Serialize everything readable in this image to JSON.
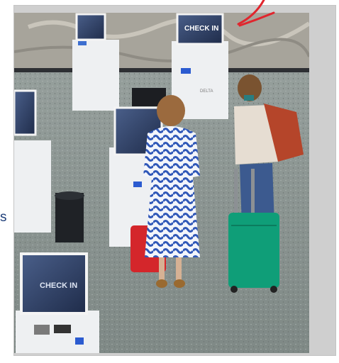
{
  "scene": {
    "kiosk_screen_text": [
      "CHECK IN",
      "CHECK IN"
    ],
    "kiosk_brand": "DELTA"
  },
  "page": {
    "side_letter": "s",
    "annotation_color": "#e0262e"
  }
}
